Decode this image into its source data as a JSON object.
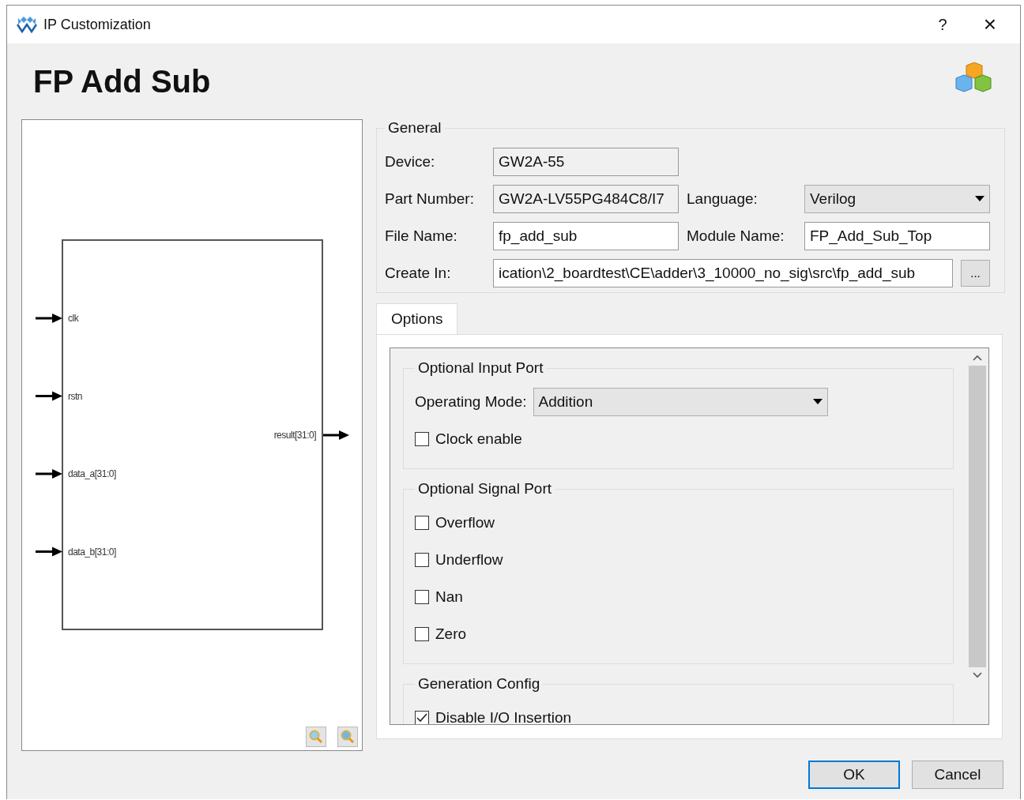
{
  "window": {
    "title": "IP Customization",
    "help": "?",
    "close": "×"
  },
  "header": {
    "title": "FP Add Sub"
  },
  "diagram": {
    "inputs": [
      {
        "label": "clk"
      },
      {
        "label": "rstn"
      },
      {
        "label": "data_a[31:0]"
      },
      {
        "label": "data_b[31:0]"
      }
    ],
    "outputs": [
      {
        "label": "result[31:0]"
      }
    ]
  },
  "general": {
    "title": "General",
    "rows": [
      {
        "cells": [
          {
            "label": "Device:",
            "kind": "readonly",
            "value": "GW2A-55"
          }
        ]
      },
      {
        "cells": [
          {
            "label": "Part Number:",
            "kind": "readonly",
            "value": "GW2A-LV55PG484C8/I7"
          },
          {
            "label": "Language:",
            "kind": "dropdown",
            "value": "Verilog"
          }
        ]
      },
      {
        "cells": [
          {
            "label": "File Name:",
            "kind": "text",
            "value": "fp_add_sub"
          },
          {
            "label": "Module Name:",
            "kind": "text",
            "value": "FP_Add_Sub_Top"
          }
        ]
      },
      {
        "cells": [
          {
            "label": "Create In:",
            "kind": "path",
            "value": "ication\\2_boardtest\\CE\\adder\\3_10000_no_sig\\src\\fp_add_sub",
            "button": "..."
          }
        ]
      }
    ]
  },
  "tabs": [
    {
      "label": "Options",
      "selected": true
    }
  ],
  "options": [
    {
      "title": "Optional Input Port",
      "items": [
        {
          "kind": "dropdown",
          "label": "Operating Mode:",
          "value": "Addition"
        },
        {
          "kind": "checkbox",
          "label": "Clock enable",
          "checked": false
        }
      ]
    },
    {
      "title": "Optional Signal Port",
      "items": [
        {
          "kind": "checkbox",
          "label": "Overflow",
          "checked": false
        },
        {
          "kind": "checkbox",
          "label": "Underflow",
          "checked": false
        },
        {
          "kind": "checkbox",
          "label": "Nan",
          "checked": false
        },
        {
          "kind": "checkbox",
          "label": "Zero",
          "checked": false
        }
      ]
    },
    {
      "title": "Generation Config",
      "items": [
        {
          "kind": "checkbox",
          "label": "Disable I/O Insertion",
          "checked": true
        }
      ]
    }
  ],
  "buttons": [
    {
      "label": "OK",
      "default": true
    },
    {
      "label": "Cancel",
      "default": false
    }
  ]
}
